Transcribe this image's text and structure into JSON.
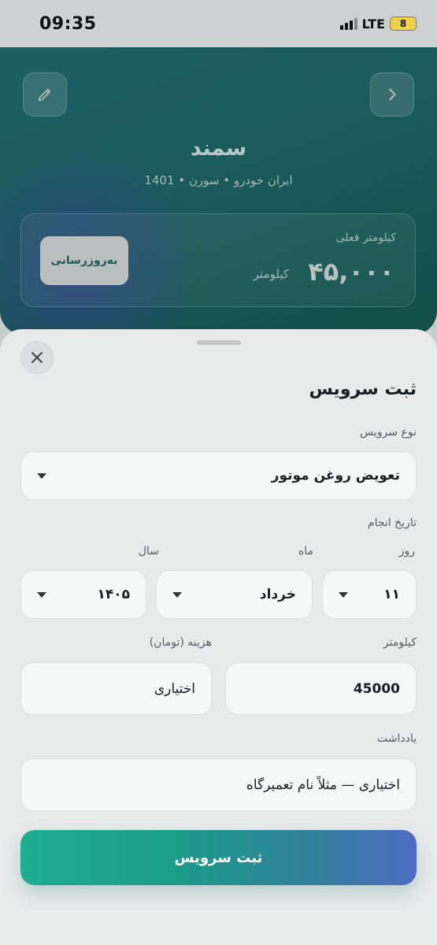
{
  "status_bar": {
    "time": "09:35",
    "network": "LTE",
    "battery": "8"
  },
  "header": {
    "car_name": "سمند",
    "car_details": "ایران خودرو • سورن • 1401",
    "km_card": {
      "label": "کیلومتر فعلی",
      "value": "۴۵,۰۰۰",
      "unit": "کیلومتر",
      "update_label": "به‌روزرسانی"
    }
  },
  "sheet": {
    "title": "ثبت سرویس",
    "service_type": {
      "label": "نوع سرویس",
      "value": "تعویض روغن موتور"
    },
    "date": {
      "label": "تاریخ انجام",
      "day_label": "روز",
      "month_label": "ماه",
      "year_label": "سال",
      "day_value": "۱۱",
      "month_value": "خرداد",
      "year_value": "۱۴۰۵"
    },
    "km": {
      "label": "کیلومتر",
      "value": "45000"
    },
    "cost": {
      "label": "هزینه (تومان)",
      "placeholder": "اختیاری"
    },
    "note": {
      "label": "یادداشت",
      "placeholder": "اختیاری — مثلاً نام تعمیرگاه"
    },
    "submit_label": "ثبت سرویس"
  }
}
